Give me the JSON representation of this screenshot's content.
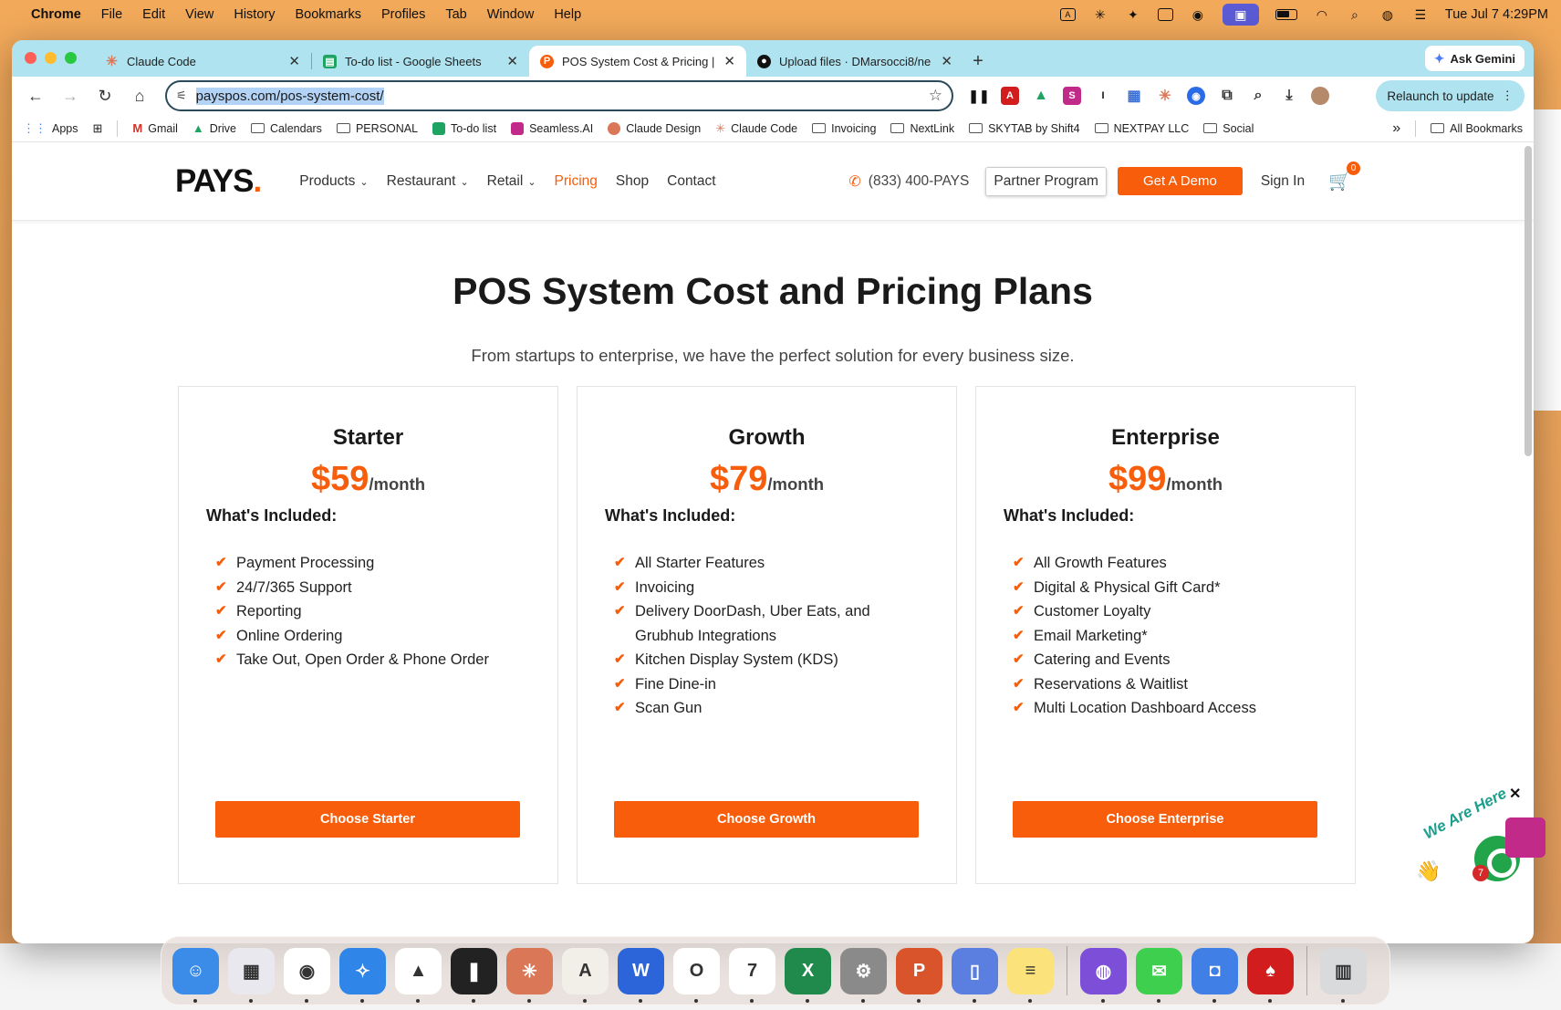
{
  "menubar": {
    "items": [
      "Chrome",
      "File",
      "Edit",
      "View",
      "History",
      "Bookmarks",
      "Profiles",
      "Tab",
      "Window",
      "Help"
    ],
    "datetime": "Tue Jul 7  4:29PM"
  },
  "browser": {
    "tabs": [
      {
        "title": "Claude Code",
        "favicon": "claude-icon",
        "color": "#d97757"
      },
      {
        "title": "To-do list - Google Sheets",
        "favicon": "sheets-icon",
        "color": "#1ea362"
      },
      {
        "title": "POS System Cost & Pricing | P",
        "favicon": "pays-icon",
        "color": "#f75d0a",
        "active": true
      },
      {
        "title": "Upload files · DMarsocci8/ne",
        "favicon": "github-icon",
        "color": "#111111"
      }
    ],
    "ask_gemini": "Ask Gemini",
    "url": "payspos.com/pos-system-cost/",
    "relaunch": "Relaunch to update",
    "bookmarks": [
      {
        "label": "Apps",
        "icon": "apps-grid-icon"
      },
      {
        "label": "",
        "icon": "tab-groups-icon"
      },
      {
        "label": "Gmail",
        "icon": "gmail-icon"
      },
      {
        "label": "Drive",
        "icon": "drive-icon"
      },
      {
        "label": "Calendars",
        "icon": "folder-icon"
      },
      {
        "label": "PERSONAL",
        "icon": "folder-icon"
      },
      {
        "label": "To-do list",
        "icon": "sheets-icon"
      },
      {
        "label": "Seamless.AI",
        "icon": "seamless-icon"
      },
      {
        "label": "Claude Design",
        "icon": "claude-design-icon"
      },
      {
        "label": "Claude Code",
        "icon": "claude-icon"
      },
      {
        "label": "Invoicing",
        "icon": "folder-icon"
      },
      {
        "label": "NextLink",
        "icon": "folder-icon"
      },
      {
        "label": "SKYTAB by Shift4",
        "icon": "folder-icon"
      },
      {
        "label": "NEXTPAY LLC",
        "icon": "folder-icon"
      },
      {
        "label": "Social",
        "icon": "folder-icon"
      }
    ],
    "more": "»",
    "all_bookmarks": "All Bookmarks"
  },
  "site": {
    "logo": "PAYS",
    "logo_dot": ".",
    "nav": [
      {
        "label": "Products",
        "dropdown": true
      },
      {
        "label": "Restaurant",
        "dropdown": true
      },
      {
        "label": "Retail",
        "dropdown": true
      },
      {
        "label": "Pricing",
        "active": true
      },
      {
        "label": "Shop"
      },
      {
        "label": "Contact"
      }
    ],
    "phone": "(833) 400-PAYS",
    "partner": "Partner Program",
    "demo": "Get A Demo",
    "signin": "Sign In",
    "cart_count": "0"
  },
  "hero": {
    "title": "POS System Cost and Pricing Plans",
    "subtitle": "From startups to enterprise, we have the perfect solution for every business size."
  },
  "plans": [
    {
      "name": "Starter",
      "price": "$59",
      "period": "/month",
      "included_label": "What's Included:",
      "features": [
        "Payment Processing",
        "24/7/365 Support",
        "Reporting",
        "Online Ordering",
        "Take Out, Open Order & Phone Order"
      ],
      "cta": "Choose Starter"
    },
    {
      "name": "Growth",
      "price": "$79",
      "period": "/month",
      "included_label": "What's Included:",
      "features": [
        "All Starter Features",
        "Invoicing",
        "Delivery DoorDash, Uber Eats, and Grubhub Integrations",
        "Kitchen Display System (KDS)",
        "Fine Dine-in",
        "Scan Gun"
      ],
      "cta": "Choose Growth"
    },
    {
      "name": "Enterprise",
      "price": "$99",
      "period": "/month",
      "included_label": "What's Included:",
      "features": [
        "All Growth Features",
        "Digital & Physical Gift Card*",
        "Customer Loyalty",
        "Email Marketing*",
        "Catering and Events",
        "Reservations & Waitlist",
        "Multi Location Dashboard Access"
      ],
      "cta": "Choose Enterprise"
    }
  ],
  "chat_widget": {
    "tagline": "We Are Here",
    "badge": "7"
  },
  "dock": [
    {
      "name": "finder",
      "color": "#3b8be8",
      "glyph": "☺"
    },
    {
      "name": "launchpad",
      "color": "#e8e8ee",
      "glyph": "▦"
    },
    {
      "name": "chrome",
      "color": "#ffffff",
      "glyph": "◉"
    },
    {
      "name": "safari",
      "color": "#2f86e8",
      "glyph": "✧"
    },
    {
      "name": "google-drive",
      "color": "#ffffff",
      "glyph": "▲"
    },
    {
      "name": "gauges-app",
      "color": "#222222",
      "glyph": "❚"
    },
    {
      "name": "claude",
      "color": "#d97757",
      "glyph": "✳"
    },
    {
      "name": "anthropic",
      "color": "#f2efe8",
      "glyph": "A"
    },
    {
      "name": "word",
      "color": "#2b65d9",
      "glyph": "W"
    },
    {
      "name": "opera",
      "color": "#ffffff",
      "glyph": "O"
    },
    {
      "name": "calendar",
      "color": "#ffffff",
      "glyph": "7"
    },
    {
      "name": "excel",
      "color": "#1f8a4c",
      "glyph": "X"
    },
    {
      "name": "system-settings",
      "color": "#8a8a8a",
      "glyph": "⚙"
    },
    {
      "name": "powerpoint",
      "color": "#d9532b",
      "glyph": "P"
    },
    {
      "name": "device-app",
      "color": "#5b7fe0",
      "glyph": "▯"
    },
    {
      "name": "notes",
      "color": "#fbe27a",
      "glyph": "≡"
    },
    {
      "name": "github-desktop",
      "color": "#7d4fd8",
      "glyph": "◍"
    },
    {
      "name": "messages",
      "color": "#3ecf4f",
      "glyph": "✉"
    },
    {
      "name": "robot-app",
      "color": "#3f7fe6",
      "glyph": "◘"
    },
    {
      "name": "acrobat",
      "color": "#d11d1d",
      "glyph": "♠"
    },
    {
      "name": "trash",
      "color": "#d9dadc",
      "glyph": "▥"
    }
  ],
  "colors": {
    "brand": "#f75d0a",
    "tabstrip": "#aee3ef"
  }
}
